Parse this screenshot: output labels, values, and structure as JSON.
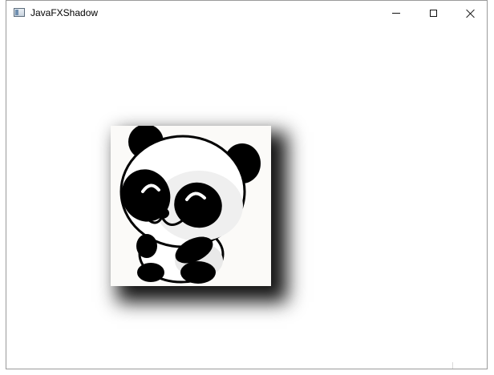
{
  "window": {
    "title": "JavaFXShadow",
    "controls": {
      "minimize_icon": "minimize-icon",
      "maximize_icon": "maximize-icon",
      "close_icon": "close-icon"
    }
  },
  "content": {
    "image": {
      "subject": "panda",
      "effect": "drop-shadow",
      "shadow_color": "#000000",
      "background_color": "#fbfaf8"
    }
  }
}
